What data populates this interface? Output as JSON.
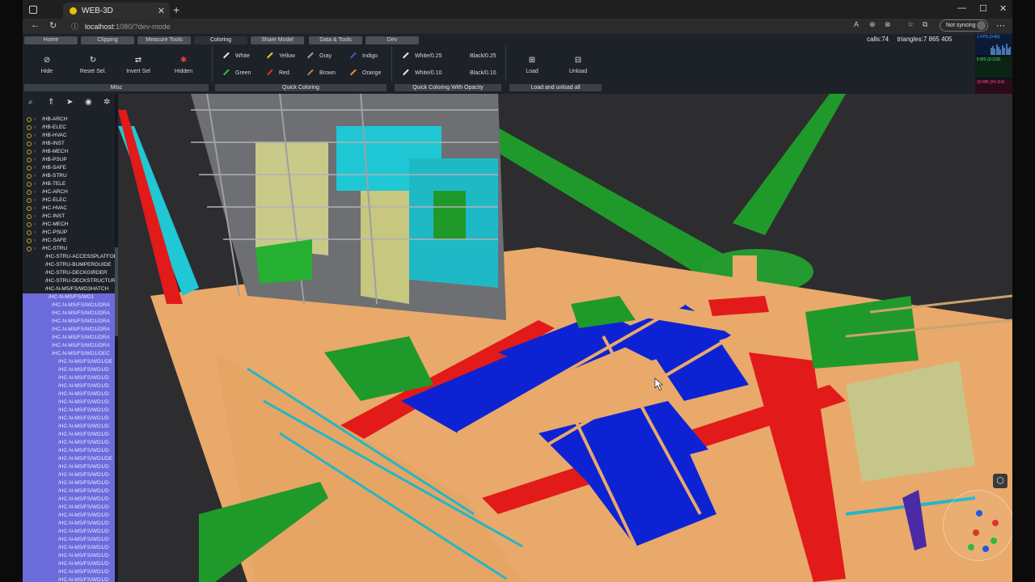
{
  "browser": {
    "tab_title": "WEB-3D",
    "url_host": "localhost",
    "url_path": ":1080/?dev-mode",
    "sync_label": "Not syncing"
  },
  "ribbon": {
    "tabs": [
      "Home",
      "Clipping",
      "Measure Tools",
      "Coloring",
      "Share Model",
      "Data & Tools",
      "Dev"
    ],
    "active_tab": "Coloring",
    "stats": {
      "calls": "calls:74",
      "triangles": "triangles:7 865 405"
    },
    "misc": {
      "hide": "Hide",
      "reset_sel": "Reset Sel.",
      "invert_sel": "Invert Sel",
      "hidden": "Hidden",
      "group": "Misc"
    },
    "quick_coloring": {
      "items": [
        {
          "label": "White",
          "color": "#e8e8e8"
        },
        {
          "label": "Yellow",
          "color": "#e0d020"
        },
        {
          "label": "Gray",
          "color": "#a0a0a0"
        },
        {
          "label": "Indigo",
          "color": "#5050e0"
        },
        {
          "label": "Green",
          "color": "#30c040"
        },
        {
          "label": "Red",
          "color": "#e03030"
        },
        {
          "label": "Brown",
          "color": "#c08040"
        },
        {
          "label": "Orange",
          "color": "#f09020"
        }
      ],
      "group": "Quick Coloring"
    },
    "opacity_coloring": {
      "items": [
        {
          "label": "White/0.25",
          "color": "#e8e8e8"
        },
        {
          "label": "Black/0.25",
          "color": "#202020"
        },
        {
          "label": "White/0.10",
          "color": "#e8e8e8"
        },
        {
          "label": "Black/0.10",
          "color": "#202020"
        }
      ],
      "group": "Quick Coloring With Opacity"
    },
    "load": {
      "load": "Load",
      "unload": "Unload",
      "group": "Load and unload all"
    },
    "fps": {
      "fps": "1 FPS (0-60)",
      "ms": "5 MS (0-103)",
      "mb": "33 MB (24-114)"
    }
  },
  "tree": {
    "items": [
      "/HB-ARCH",
      "/HB-ELEC",
      "/HB-HVAC",
      "/HB-INST",
      "/HB-MECH",
      "/HB-PSUP",
      "/HB-SAFE",
      "/HB-STRU",
      "/HB-TELE",
      "/HC-ARCH",
      "/HC-ELEC",
      "/HC-HVAC",
      "/HC-INST",
      "/HC-MECH",
      "/HC-PSUP",
      "/HC-SAFE",
      "/HC-STRU",
      "/HC-STRU-ACCESSPLATFOR",
      "/HC-STRU-BUMPERGUIDE",
      "/HC-STRU-DECKGIRDER",
      "/HC-STRU-DECKSTRUCTUR",
      "/HC-N-MS/FS/WD3HATCH",
      "/HC-N-MS/FS/WD1",
      "/HC-N-MS/FS/WD1/DRA",
      "/HC-N-MS/FS/WD1/DRA",
      "/HC-N-MS/FS/WD1/DRA",
      "/HC-N-MS/FS/WD1/DRA",
      "/HC-N-MS/FS/WD1/DRA",
      "/HC-N-MS/FS/WD1/DRA",
      "/HC-N-MS/FS/WD1/DEC",
      "/HC-N-MS/FS/WD1/DE",
      "/HC-N-MS/FS/WD1/D",
      "/HC-N-MS/FS/WD1/D",
      "/HC-N-MS/FS/WD1/D",
      "/HC-N-MS/FS/WD1/D",
      "/HC-N-MS/FS/WD1/D",
      "/HC-N-MS/FS/WD1/D",
      "/HC-N-MS/FS/WD1/D",
      "/HC-N-MS/FS/WD1/D",
      "/HC-N-MS/FS/WD1/D",
      "/HC-N-MS/FS/WD1/D",
      "/HC-N-MS/FS/WD1/D",
      "/HC-N-MS/FS/WD1/DE",
      "/HC-N-MS/FS/WD1/D",
      "/HC-N-MS/FS/WD1/D",
      "/HC-N-MS/FS/WD1/D",
      "/HC-N-MS/FS/WD1/D",
      "/HC-N-MS/FS/WD1/D",
      "/HC-N-MS/FS/WD1/D",
      "/HC-N-MS/FS/WD1/D",
      "/HC-N-MS/FS/WD1/D",
      "/HC-N-MS/FS/WD1/D",
      "/HC-N-MS/FS/WD1/D",
      "/HC-N-MS/FS/WD1/D",
      "/HC-N-MS/FS/WD1/D",
      "/HC-N-MS/FS/WD1/D",
      "/HC-N-MS/FS/WD1/D",
      "/HC-N-MS/FS/WD1/D"
    ]
  }
}
